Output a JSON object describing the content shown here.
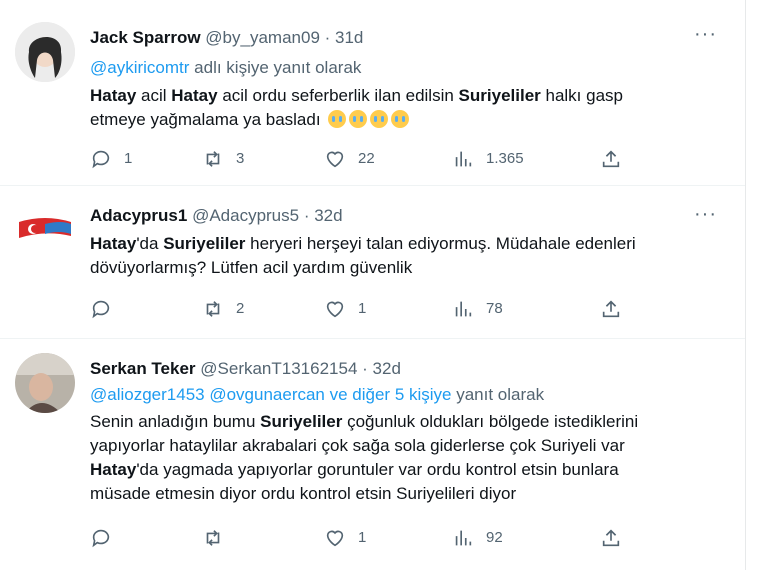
{
  "tweets": [
    {
      "name": "Jack Sparrow",
      "handle": "@by_yaman09",
      "time": "· 31d",
      "reply_to": "@aykiricomtr",
      "reply_suffix": " adlı kişiye yanıt olarak",
      "line1": [
        {
          "t": "Hatay",
          "b": true
        },
        {
          "t": " acil ",
          "b": false
        },
        {
          "t": "Hatay",
          "b": true
        },
        {
          "t": " acil ordu seferberlik ilan edilsin ",
          "b": false
        },
        {
          "t": "Suriyeliler",
          "b": true
        },
        {
          "t": " halkı gasp",
          "b": false
        }
      ],
      "line2": "etmeye yağmalama ya basladı",
      "emoji": "crying-face-emoji",
      "replies": "1",
      "retweets": "3",
      "likes": "22",
      "views": "1.365"
    },
    {
      "name": "Adacyprus1",
      "handle": "@Adacyprus5",
      "time": "· 32d",
      "line1": [
        {
          "t": "Hatay",
          "b": true
        },
        {
          "t": "'da ",
          "b": false
        },
        {
          "t": "Suriyeliler",
          "b": true
        },
        {
          "t": " heryeri herşeyi talan ediyormuş. Müdahale edenleri",
          "b": false
        }
      ],
      "line2": "dövüyorlarmış? Lütfen acil yardım güvenlik",
      "replies": "",
      "retweets": "2",
      "likes": "1",
      "views": "78"
    },
    {
      "name": "Serkan Teker",
      "handle": "@SerkanT13162154",
      "time": "· 32d",
      "reply_to": "@aliozger1453 @ovgunaercan  ve diğer 5 kişiye",
      "reply_suffix": " yanıt olarak",
      "line1": [
        {
          "t": "Senin anladığın bumu ",
          "b": false
        },
        {
          "t": "Suriyeliler",
          "b": true
        },
        {
          "t": " çoğunluk oldukları bölgede istediklerini",
          "b": false
        }
      ],
      "line2": "yapıyorlar hataylilar akrabalari çok sağa sola giderlerse çok Suriyeli var",
      "line3": [
        {
          "t": "Hatay",
          "b": true
        },
        {
          "t": "'da yagmada yapıyorlar goruntuler var ordu kontrol etsin bunlara",
          "b": false
        }
      ],
      "line4": "müsade etmesin diyor ordu kontrol etsin Suriyelileri diyor",
      "replies": "",
      "retweets": "",
      "likes": "1",
      "views": "92"
    }
  ],
  "more_label": "···"
}
